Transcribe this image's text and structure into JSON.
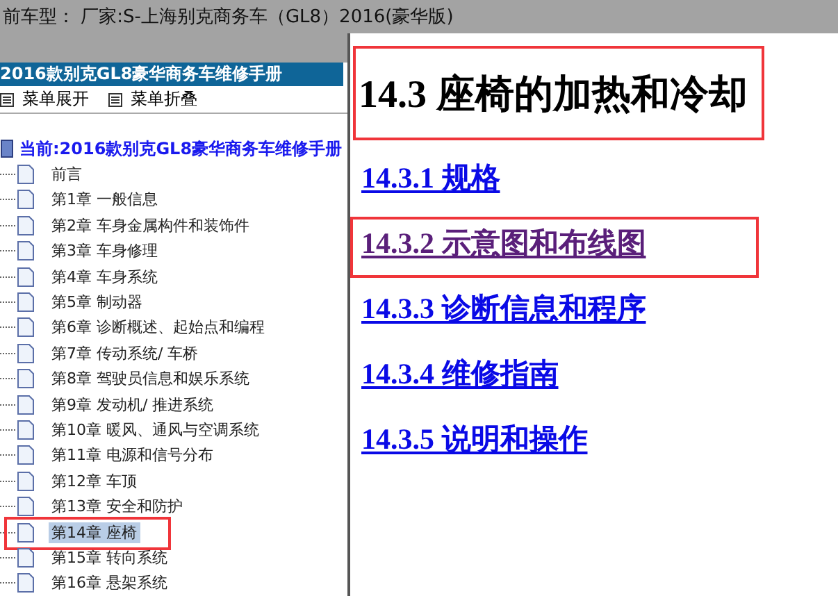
{
  "title_bar": {
    "text": "前车型：  厂家:S-上海别克商务车（GL8）2016(豪华版)"
  },
  "sidebar": {
    "header": "2016款别克GL8豪华商务车维修手册",
    "toolbar": [
      {
        "label": "菜单展开"
      },
      {
        "label": "菜单折叠"
      }
    ],
    "root": "当前:2016款别克GL8豪华商务车维修手册",
    "items": [
      {
        "label": "前言",
        "selected": false,
        "highlighted": false
      },
      {
        "label": "第1章 一般信息",
        "selected": false,
        "highlighted": false
      },
      {
        "label": "第2章 车身金属构件和装饰件",
        "selected": false,
        "highlighted": false
      },
      {
        "label": "第3章 车身修理",
        "selected": false,
        "highlighted": false
      },
      {
        "label": "第4章 车身系统",
        "selected": false,
        "highlighted": false
      },
      {
        "label": "第5章 制动器",
        "selected": false,
        "highlighted": false
      },
      {
        "label": "第6章 诊断概述、起始点和编程",
        "selected": false,
        "highlighted": false
      },
      {
        "label": "第7章 传动系统/ 车桥",
        "selected": false,
        "highlighted": false
      },
      {
        "label": "第8章 驾驶员信息和娱乐系统",
        "selected": false,
        "highlighted": false
      },
      {
        "label": "第9章 发动机/ 推进系统",
        "selected": false,
        "highlighted": false
      },
      {
        "label": "第10章 暖风、通风与空调系统",
        "selected": false,
        "highlighted": false
      },
      {
        "label": "第11章 电源和信号分布",
        "selected": false,
        "highlighted": false
      },
      {
        "label": "第12章 车顶",
        "selected": false,
        "highlighted": false
      },
      {
        "label": "第13章 安全和防护",
        "selected": false,
        "highlighted": false
      },
      {
        "label": "第14章 座椅",
        "selected": true,
        "highlighted": true
      },
      {
        "label": "第15章 转向系统",
        "selected": false,
        "highlighted": false
      },
      {
        "label": "第16章 悬架系统",
        "selected": false,
        "highlighted": false
      }
    ]
  },
  "content": {
    "heading": {
      "text": "14.3 座椅的加热和冷却",
      "highlighted": true
    },
    "links": [
      {
        "label": "14.3.1 规格",
        "visited": false,
        "highlighted": false
      },
      {
        "label": "14.3.2 示意图和布线图",
        "visited": true,
        "highlighted": true
      },
      {
        "label": "14.3.3 诊断信息和程序",
        "visited": false,
        "highlighted": false
      },
      {
        "label": "14.3.4 维修指南",
        "visited": false,
        "highlighted": false
      },
      {
        "label": "14.3.5 说明和操作",
        "visited": false,
        "highlighted": false
      }
    ]
  }
}
